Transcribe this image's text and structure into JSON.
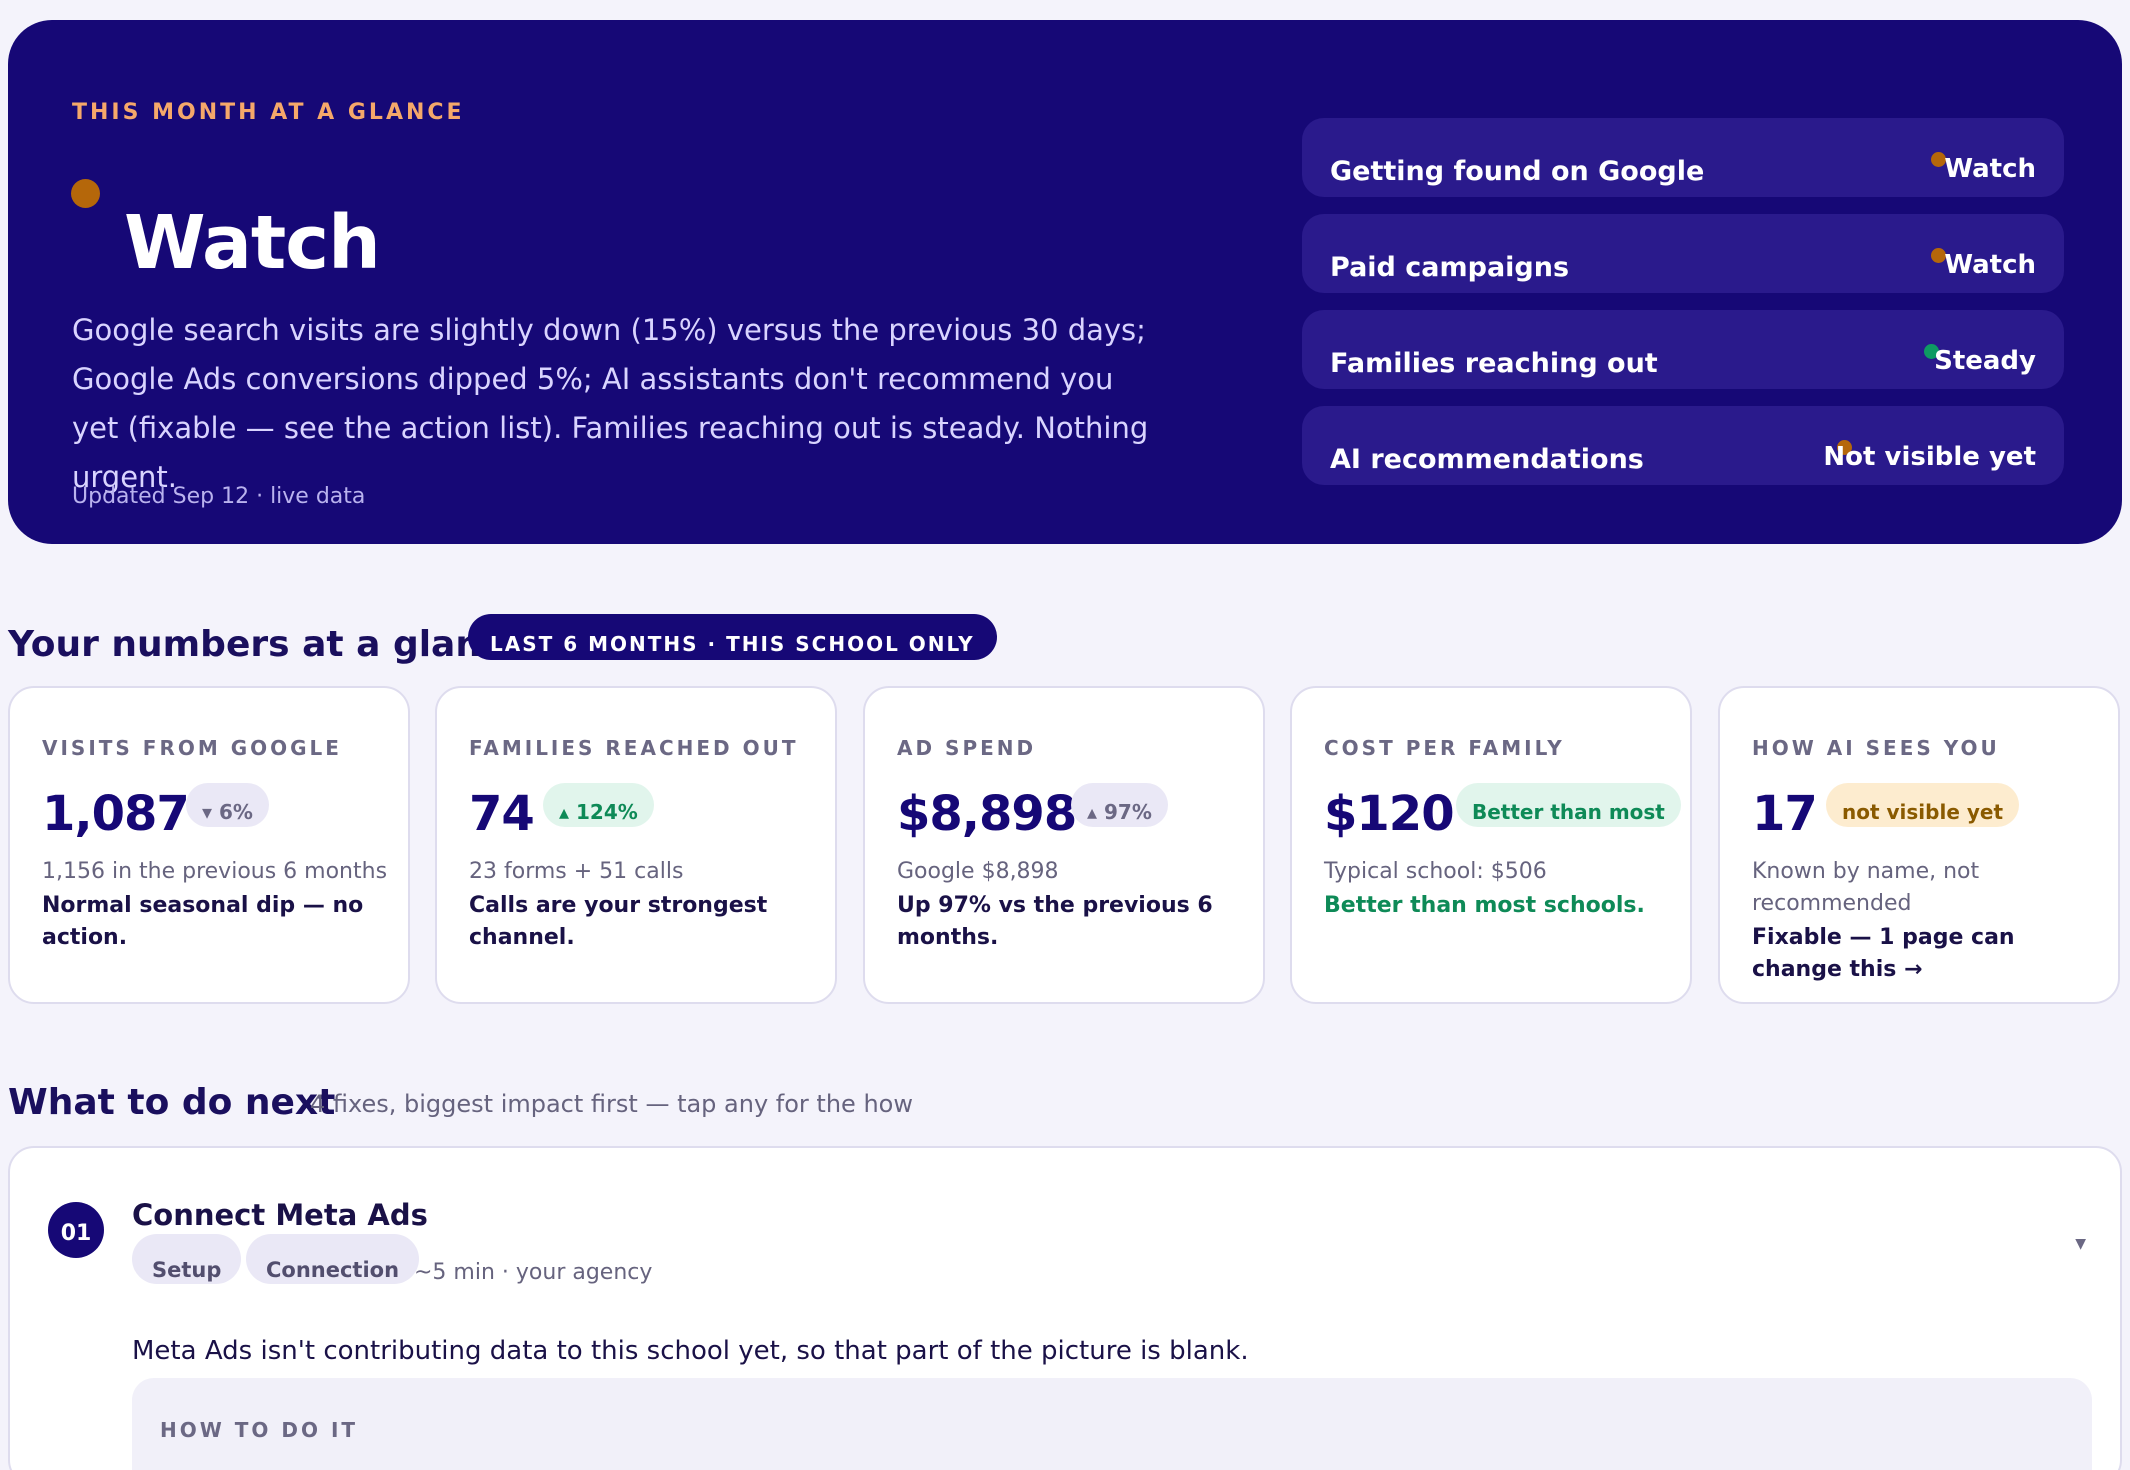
{
  "hero": {
    "kicker": "THIS MONTH AT A GLANCE",
    "status": "Watch",
    "status_color": "#b5670a",
    "summary": "Google search visits are slightly down (15%) versus the previous 30 days; Google Ads conversions dipped 5%; AI assistants don't recommend you yet (fixable — see the action list). Families reaching out is steady. Nothing urgent.",
    "updated": "Updated Sep 12 · live data",
    "signals": [
      {
        "label": "Getting found on Google",
        "status": "Watch",
        "dot_color": "#b5670a"
      },
      {
        "label": "Paid campaigns",
        "status": "Watch",
        "dot_color": "#b5670a"
      },
      {
        "label": "Families reaching out",
        "status": "Steady",
        "dot_color": "#0e9a63"
      },
      {
        "label": "AI recommendations",
        "status": "Not visible yet",
        "dot_color": "#b5670a"
      }
    ]
  },
  "numbers": {
    "title": "Your numbers at a glance",
    "pill": "LAST 6 MONTHS · THIS SCHOOL ONLY",
    "cards": [
      {
        "kicker": "VISITS FROM GOOGLE",
        "value": "1,087",
        "badge": "▾ 6%",
        "sub": "1,156   in the previous 6 months",
        "note": "Normal seasonal dip — no action."
      },
      {
        "kicker": "FAMILIES REACHED OUT",
        "value": "74",
        "badge": "▴ 124%",
        "sub": "23 forms + 51  calls",
        "note": "Calls are your strongest channel."
      },
      {
        "kicker": "AD SPEND",
        "value": "$8,898",
        "badge": "▴ 97%",
        "sub": "Google $8,898",
        "note": "Up 97% vs the previous 6 months."
      },
      {
        "kicker": "COST PER FAMILY",
        "value": "$120",
        "badge": "Better than most",
        "sub": "Typical school: $506",
        "note": "Better than most schools."
      },
      {
        "kicker": "HOW AI SEES YOU",
        "value": "17",
        "badge": "not visible yet",
        "sub": "Known by name, not recommended",
        "note": "Fixable — 1 page can change this →"
      }
    ]
  },
  "next": {
    "title": "What to do next",
    "subtitle": "4 fixes, biggest impact first — tap any for the how",
    "action": {
      "number": "01",
      "title": "Connect Meta Ads",
      "tags": [
        "Setup",
        "Connection"
      ],
      "meta": "~5 min · your agency",
      "description": "Meta Ads isn't contributing data to this school yet, so that part of the picture is blank.",
      "howto_label": "HOW TO DO IT"
    }
  }
}
